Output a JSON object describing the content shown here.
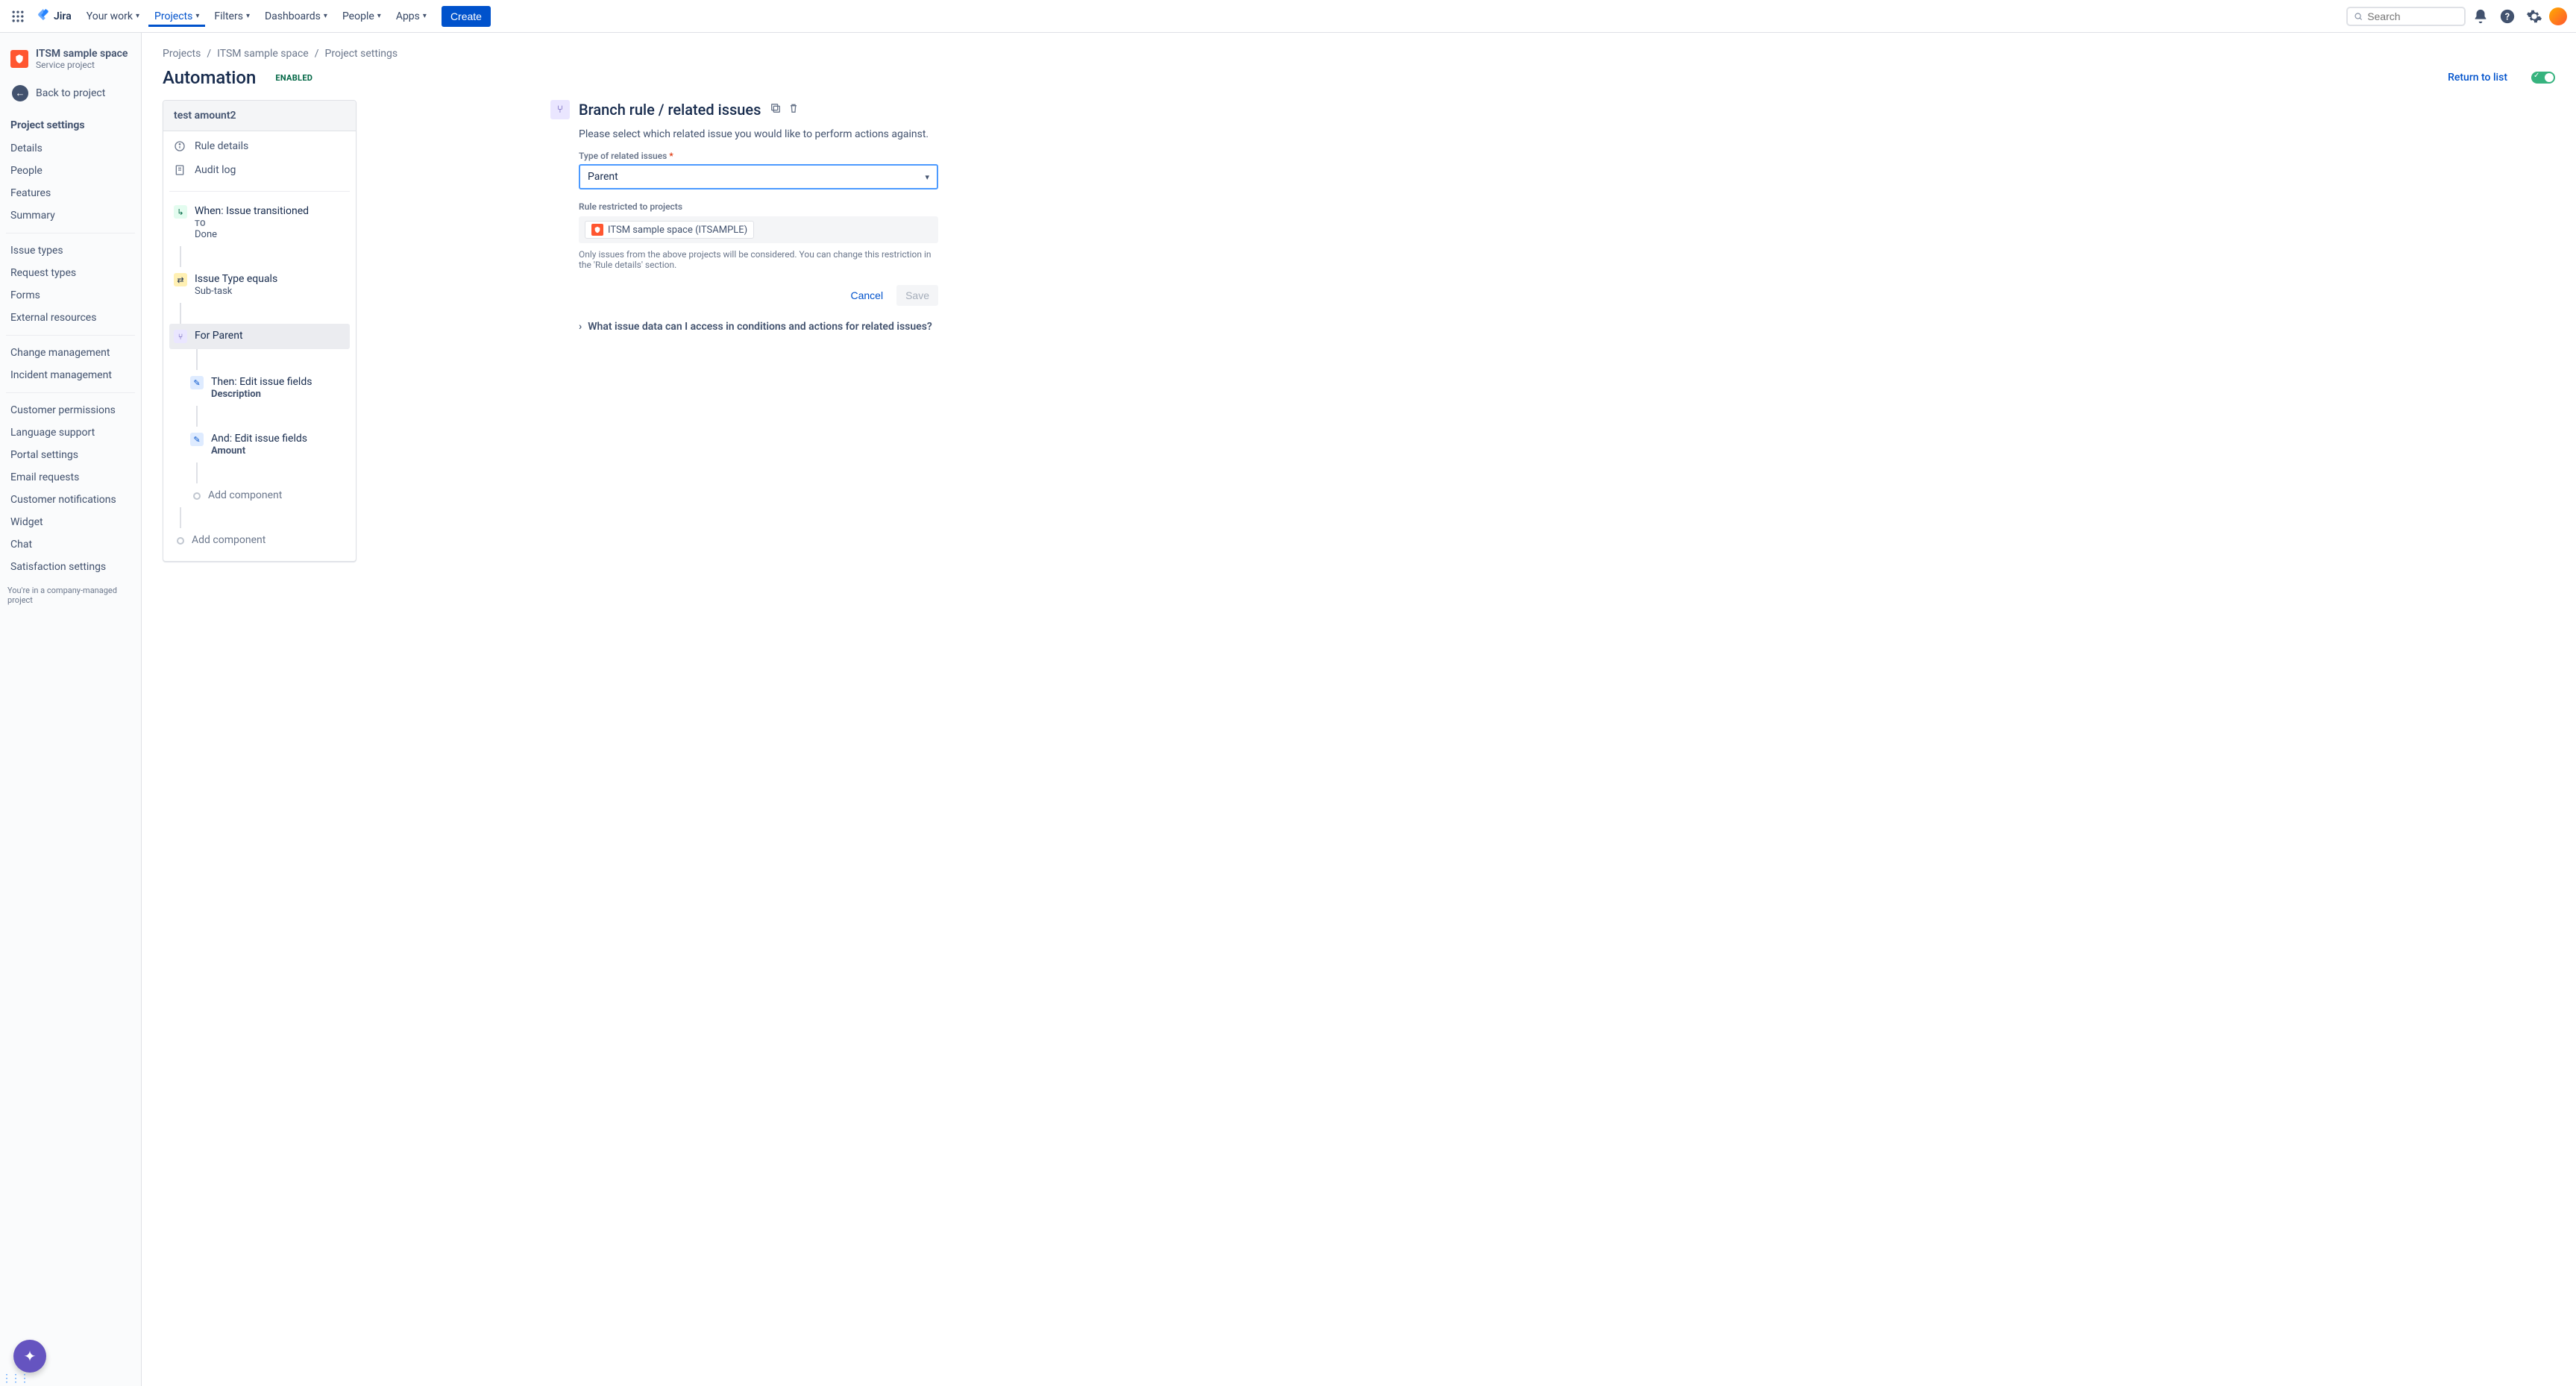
{
  "nav": {
    "product": "Jira",
    "your_work": "Your work",
    "projects": "Projects",
    "filters": "Filters",
    "dashboards": "Dashboards",
    "people": "People",
    "apps": "Apps",
    "create": "Create",
    "search_placeholder": "Search"
  },
  "sidebar": {
    "project_name": "ITSM sample space",
    "project_type": "Service project",
    "back": "Back to project",
    "heading": "Project settings",
    "groups": [
      [
        "Details",
        "People",
        "Features",
        "Summary"
      ],
      [
        "Issue types",
        "Request types",
        "Forms",
        "External resources"
      ],
      [
        "Change management",
        "Incident management"
      ],
      [
        "Customer permissions",
        "Language support",
        "Portal settings",
        "Email requests",
        "Customer notifications",
        "Widget",
        "Chat",
        "Satisfaction settings"
      ]
    ],
    "footer": "You're in a company-managed project"
  },
  "breadcrumb": [
    "Projects",
    "ITSM sample space",
    "Project settings"
  ],
  "page": {
    "title": "Automation",
    "status": "ENABLED",
    "return": "Return to list"
  },
  "rule": {
    "name": "test amount2",
    "details": "Rule details",
    "audit": "Audit log",
    "trigger_title": "When: Issue transitioned",
    "trigger_sub1": "TO",
    "trigger_sub2": "Done",
    "cond_title": "Issue Type equals",
    "cond_sub": "Sub-task",
    "branch_title": "For Parent",
    "action1_title": "Then: Edit issue fields",
    "action1_sub": "Description",
    "action2_title": "And: Edit issue fields",
    "action2_sub": "Amount",
    "add_component": "Add component"
  },
  "detail": {
    "title": "Branch rule / related issues",
    "desc": "Please select which related issue you would like to perform actions against.",
    "type_label": "Type of related issues",
    "type_value": "Parent",
    "restrict_label": "Rule restricted to projects",
    "project_chip": "ITSM sample space (ITSAMPLE)",
    "help": "Only issues from the above projects will be considered. You can change this restriction in the 'Rule details' section.",
    "cancel": "Cancel",
    "save": "Save",
    "expand": "What issue data can I access in conditions and actions for related issues?"
  }
}
